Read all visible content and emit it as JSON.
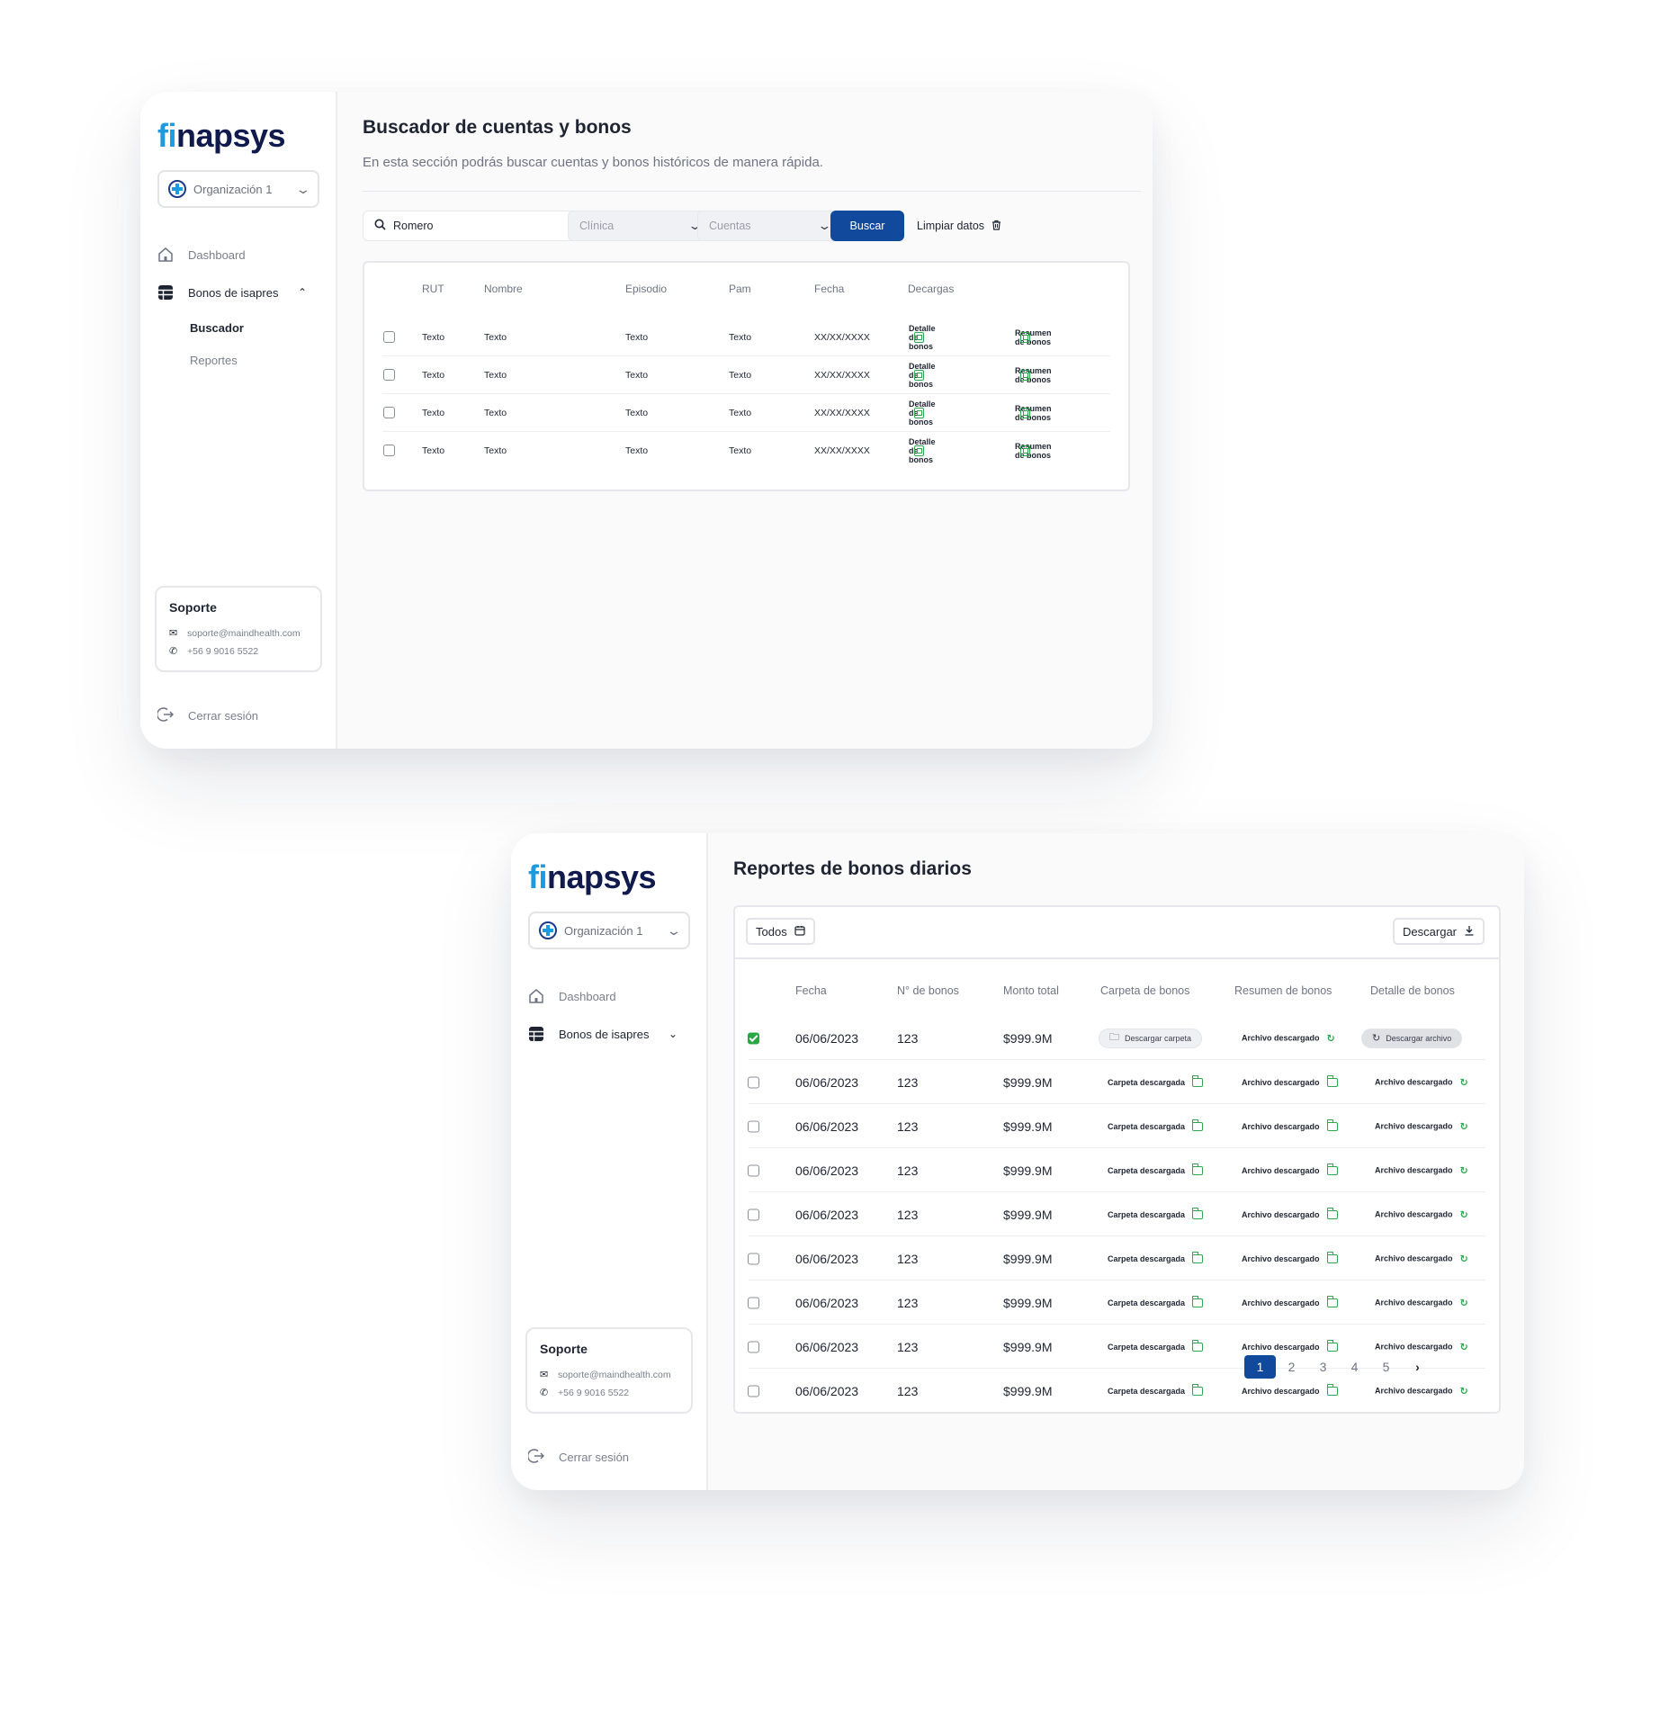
{
  "brand": {
    "prefix": "fi",
    "rest": "napsys"
  },
  "sidebar": {
    "org": "Organización 1",
    "nav": {
      "dashboard": "Dashboard",
      "bonos": "Bonos de isapres",
      "buscador": "Buscador",
      "reportes": "Reportes"
    },
    "support": {
      "title": "Soporte",
      "email": "soporte@maindhealth.com",
      "phone": "+56 9 9016 5522"
    },
    "logout": "Cerrar sesión"
  },
  "search_page": {
    "title": "Buscador de cuentas y bonos",
    "subtitle": "En esta sección podrás buscar cuentas y bonos históricos de manera rápida.",
    "search_value": "Romero",
    "filter_clinica": "Clínica",
    "filter_cuentas": "Cuentas",
    "buscar": "Buscar",
    "limpiar": "Limpiar datos",
    "headers": [
      "RUT",
      "Nombre",
      "Episodio",
      "Pam",
      "Fecha",
      "Decargas"
    ],
    "rows": [
      {
        "rut": "Texto",
        "nombre": "Texto",
        "episodio": "Texto",
        "pam": "Texto",
        "fecha": "XX/XX/XXXX",
        "d1": "Detalle de bonos",
        "d2": "Resumen de bonos"
      },
      {
        "rut": "Texto",
        "nombre": "Texto",
        "episodio": "Texto",
        "pam": "Texto",
        "fecha": "XX/XX/XXXX",
        "d1": "Detalle de bonos",
        "d2": "Resumen de bonos"
      },
      {
        "rut": "Texto",
        "nombre": "Texto",
        "episodio": "Texto",
        "pam": "Texto",
        "fecha": "XX/XX/XXXX",
        "d1": "Detalle de bonos",
        "d2": "Resumen de bonos"
      },
      {
        "rut": "Texto",
        "nombre": "Texto",
        "episodio": "Texto",
        "pam": "Texto",
        "fecha": "XX/XX/XXXX",
        "d1": "Detalle de bonos",
        "d2": "Resumen de bonos"
      }
    ]
  },
  "reports_page": {
    "title": "Reportes de bonos diarios",
    "filter_all": "Todos",
    "download": "Descargar",
    "headers": [
      "Fecha",
      "N° de bonos",
      "Monto total",
      "Carpeta de bonos",
      "Resumen de bonos",
      "Detalle de bonos"
    ],
    "rows": [
      {
        "checked": true,
        "fecha": "06/06/2023",
        "n": "123",
        "monto": "$999.9M",
        "carpeta": "Descargar carpeta",
        "resumen": "Archivo descargado",
        "detalle": "Descargar archivo"
      },
      {
        "checked": false,
        "fecha": "06/06/2023",
        "n": "123",
        "monto": "$999.9M",
        "carpeta": "Carpeta descargada",
        "resumen": "Archivo descargado",
        "detalle": "Archivo descargado"
      },
      {
        "checked": false,
        "fecha": "06/06/2023",
        "n": "123",
        "monto": "$999.9M",
        "carpeta": "Carpeta descargada",
        "resumen": "Archivo descargado",
        "detalle": "Archivo descargado"
      },
      {
        "checked": false,
        "fecha": "06/06/2023",
        "n": "123",
        "monto": "$999.9M",
        "carpeta": "Carpeta descargada",
        "resumen": "Archivo descargado",
        "detalle": "Archivo descargado"
      },
      {
        "checked": false,
        "fecha": "06/06/2023",
        "n": "123",
        "monto": "$999.9M",
        "carpeta": "Carpeta descargada",
        "resumen": "Archivo descargado",
        "detalle": "Archivo descargado"
      },
      {
        "checked": false,
        "fecha": "06/06/2023",
        "n": "123",
        "monto": "$999.9M",
        "carpeta": "Carpeta descargada",
        "resumen": "Archivo descargado",
        "detalle": "Archivo descargado"
      },
      {
        "checked": false,
        "fecha": "06/06/2023",
        "n": "123",
        "monto": "$999.9M",
        "carpeta": "Carpeta descargada",
        "resumen": "Archivo descargado",
        "detalle": "Archivo descargado"
      },
      {
        "checked": false,
        "fecha": "06/06/2023",
        "n": "123",
        "monto": "$999.9M",
        "carpeta": "Carpeta descargada",
        "resumen": "Archivo descargado",
        "detalle": "Archivo descargado"
      },
      {
        "checked": false,
        "fecha": "06/06/2023",
        "n": "123",
        "monto": "$999.9M",
        "carpeta": "Carpeta descargada",
        "resumen": "Archivo descargado",
        "detalle": "Archivo descargado"
      }
    ],
    "pages": [
      "1",
      "2",
      "3",
      "4",
      "5"
    ],
    "current_page": "1"
  },
  "colors": {
    "primary": "#114a9c",
    "brand_fi": "#1e9be0",
    "brand_text": "#111a4d",
    "success": "#2ea84f"
  }
}
